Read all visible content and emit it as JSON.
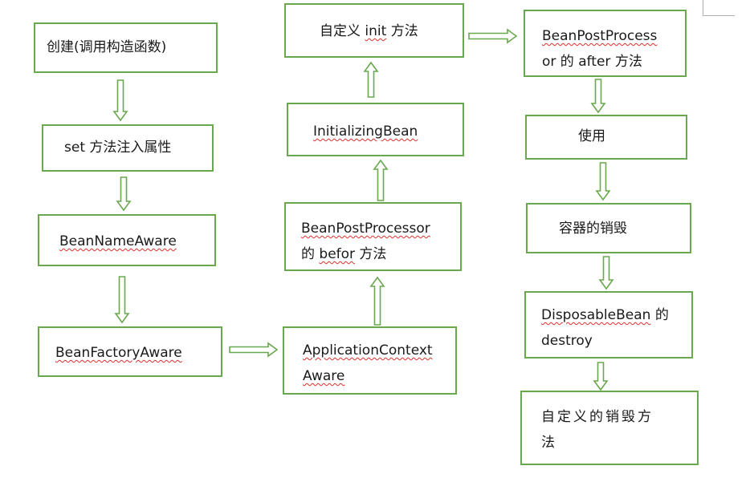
{
  "flow": {
    "create": "创建(调用构造函数)",
    "set_props": "set 方法注入属性",
    "bean_name_aware": "BeanNameAware",
    "bean_factory_aware": "BeanFactoryAware",
    "app_ctx_aware_1": "ApplicationContext",
    "app_ctx_aware_2": "Aware",
    "bpp_before_1": "BeanPostProcessor",
    "bpp_before_2_zh": "的 ",
    "bpp_before_2_en": "befor",
    "bpp_before_2_tail": " 方法",
    "initializing_bean": "InitializingBean",
    "custom_init_pre": "自定义 ",
    "custom_init_en": "init",
    "custom_init_post": " 方法",
    "bpp_after_1": "BeanPostProcess",
    "bpp_after_2": "or 的 after 方法",
    "use": "使用",
    "container_destroy": "容器的销毁",
    "disposable_1_en": "DisposableBean",
    "disposable_1_zh": " 的",
    "disposable_2": "destroy",
    "custom_destroy_1": "自定义的销毁方",
    "custom_destroy_2": "法"
  },
  "colors": {
    "border": "#6aa84f",
    "arrow": "#6aa84f",
    "spellcheck": "#e0302a"
  }
}
